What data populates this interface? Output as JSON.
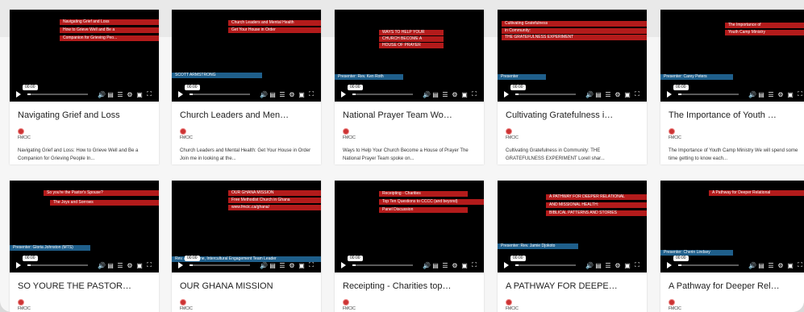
{
  "cards": [
    {
      "title": "Navigating Grief and Loss",
      "org": "FMCIC",
      "description": "Navigating Grief and Loss: How to Grieve Well and Be a Companion for Grieving People In...",
      "time_tip": "00:00",
      "progress": 0.05,
      "overlays": [
        {
          "text": "Navigating Grief and Loss",
          "color": "red"
        },
        {
          "text": "How to Grieve Well and Be a",
          "color": "red"
        },
        {
          "text": "Companion for Grieving Peo...",
          "color": "red"
        }
      ]
    },
    {
      "title": "Church Leaders and Men…",
      "org": "FMCIC",
      "description": "Church Leaders and Mental Health: Get Your House in Order Join me in looking at the...",
      "time_tip": "00:00",
      "progress": 0.05,
      "overlays": [
        {
          "text": "Church Leaders and Mental Health",
          "color": "red"
        },
        {
          "text": "Get Your House in Order",
          "color": "red"
        },
        {
          "text": "SCOTT ARMSTRONG",
          "color": "blue"
        }
      ]
    },
    {
      "title": "National Prayer Team Wo…",
      "org": "FMCIC",
      "description": "Ways to Help Your Church Become a House of Prayer The National Prayer Team spoke on...",
      "time_tip": "00:00",
      "progress": 0.05,
      "overlays": [
        {
          "text": "WAYS TO HELP YOUR",
          "color": "red"
        },
        {
          "text": "CHURCH BECOME A",
          "color": "red"
        },
        {
          "text": "HOUSE OF PRAYER",
          "color": "red"
        },
        {
          "text": "Presenter: Rev. Ken Roth",
          "color": "blue"
        }
      ]
    },
    {
      "title": "Cultivating Gratefulness i…",
      "org": "FMCIC",
      "description": "Cultivating Gratefulness in Community: THE GRATEFULNESS EXPERIMENT Lorell shar...",
      "time_tip": "00:00",
      "progress": 0.05,
      "overlays": [
        {
          "text": "Cultivating Gratefulness",
          "color": "red"
        },
        {
          "text": "in Community:",
          "color": "red"
        },
        {
          "text": "THE GRATEFULNESS EXPERIMENT",
          "color": "red"
        },
        {
          "text": "Presenter",
          "color": "blue"
        }
      ]
    },
    {
      "title": "The Importance of Youth …",
      "org": "FMCIC",
      "description": "The Importance of Youth Camp Ministry We will spend some time getting to know each...",
      "time_tip": "00:00",
      "progress": 0.05,
      "overlays": [
        {
          "text": "The Importance of",
          "color": "red"
        },
        {
          "text": "Youth Camp Ministry",
          "color": "red"
        },
        {
          "text": "Presenter: Carey Peters",
          "color": "blue"
        }
      ]
    },
    {
      "title": "SO YOURE THE PASTOR…",
      "org": "FMCIC",
      "time_tip": "00:00",
      "progress": 0.05,
      "overlays": [
        {
          "text": "So you're the Pastor's Spouse?",
          "color": "red"
        },
        {
          "text": "The Joys and Sorrows",
          "color": "red"
        },
        {
          "text": "Presenter: Gloria Johnston (MTS)",
          "color": "blue"
        }
      ]
    },
    {
      "title": "OUR GHANA MISSION",
      "org": "FMCIC",
      "time_tip": "00:00",
      "progress": 0.05,
      "overlays": [
        {
          "text": "OUR GHANA MISSION",
          "color": "red"
        },
        {
          "text": "Free Methodist Church in Ghana",
          "color": "red"
        },
        {
          "text": "www.fmcic.ca/ghana/",
          "color": "red"
        },
        {
          "text": "Rev. Adam Kline, Intercultural Engagement Team Leader",
          "color": "blue"
        }
      ]
    },
    {
      "title": "Receipting - Charities top…",
      "org": "FMCIC",
      "time_tip": "00:00",
      "progress": 0.05,
      "overlays": [
        {
          "text": "Receipting - Charities",
          "color": "red"
        },
        {
          "text": "Top Ten Questions to CCCC (and beyond)",
          "color": "red"
        },
        {
          "text": "Panel Discussion",
          "color": "red"
        }
      ]
    },
    {
      "title": "A PATHWAY FOR DEEPE…",
      "org": "FMCIC",
      "time_tip": "00:00",
      "progress": 0.05,
      "overlays": [
        {
          "text": "A PATHWAY FOR DEEPER RELATIONAL",
          "color": "red"
        },
        {
          "text": "AND MISSIONAL HEALTH:",
          "color": "red"
        },
        {
          "text": "BIBLICAL PATTERNS AND STORIES",
          "color": "red"
        },
        {
          "text": "Presenter: Rev. Jamie Djokoto",
          "color": "blue"
        }
      ]
    },
    {
      "title": "A Pathway for Deeper Rel…",
      "org": "FMCIC",
      "time_tip": "00:00",
      "progress": 0.05,
      "overlays": [
        {
          "text": "A Pathway for Deeper Relational",
          "color": "red"
        },
        {
          "text": "Presenter: Cherin Lindsey",
          "color": "blue"
        }
      ]
    }
  ],
  "controls": {
    "play_icon": "play-icon",
    "volume_icon": "volume-icon",
    "captions_icon": "captions-icon",
    "chapters_icon": "chapters-icon",
    "settings_icon": "settings-icon",
    "pip_icon": "picture-in-picture-icon",
    "fullscreen_icon": "fullscreen-icon"
  },
  "colors": {
    "overlay_red": "#b31b1b",
    "overlay_blue": "#1f5f8b",
    "thumbnail_bg": "#000000"
  }
}
